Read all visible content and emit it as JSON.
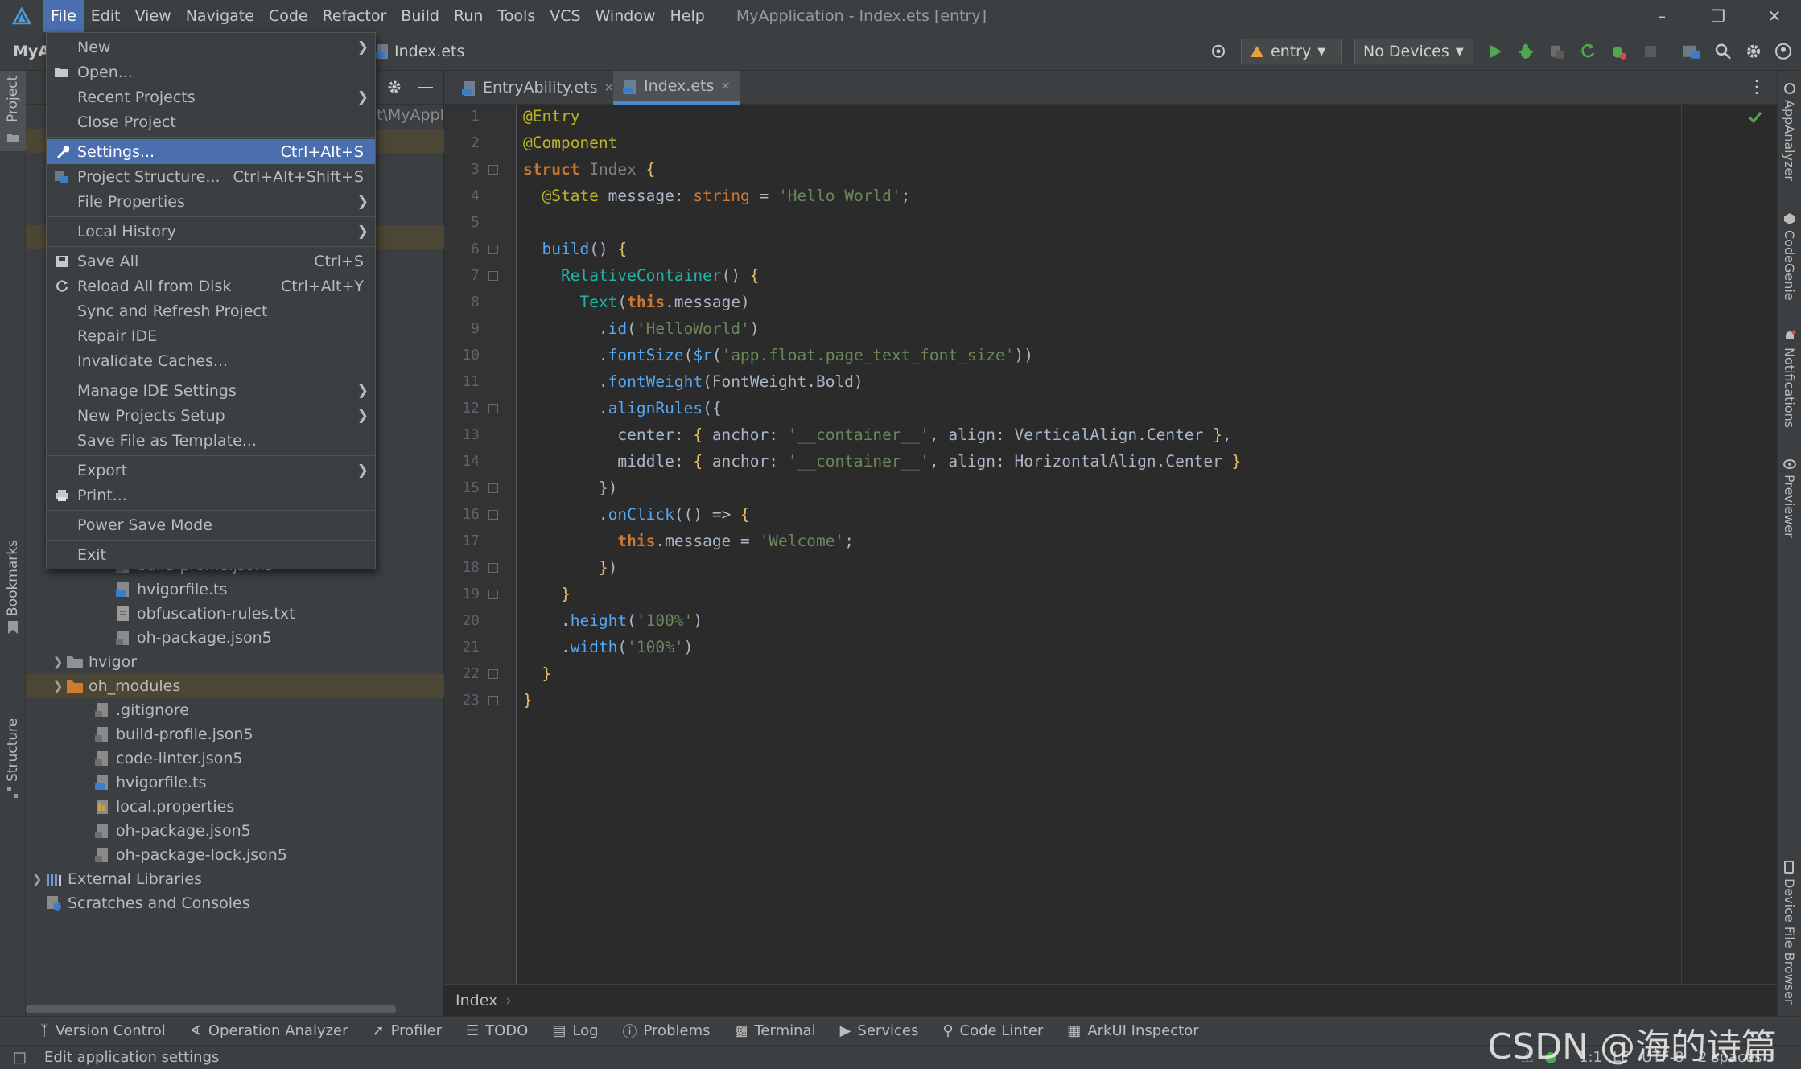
{
  "titlebar": {
    "menus": [
      "File",
      "Edit",
      "View",
      "Navigate",
      "Code",
      "Refactor",
      "Build",
      "Run",
      "Tools",
      "VCS",
      "Window",
      "Help"
    ],
    "window_title": "MyApplication - Index.ets [entry]"
  },
  "toolbar": {
    "project_label": "MyA",
    "breadcrumb_file": "Index.ets",
    "run_config": "entry",
    "device": "No Devices"
  },
  "left_stripe": {
    "project": "Project",
    "bookmarks": "Bookmarks",
    "structure": "Structure"
  },
  "right_stripe": {
    "app_analyzer": "AppAnalyzer",
    "code_genie": "CodeGenie",
    "notifications": "Notifications",
    "previewer": "Previewer",
    "device_file_browser": "Device File Browser"
  },
  "project_panel": {
    "path_fragment": "t\\MyAppl",
    "tree": [
      {
        "label": "build-profile.json5",
        "icon": "json-file-icon"
      },
      {
        "label": "hvigorfile.ts",
        "icon": "ts-file-icon"
      },
      {
        "label": "obfuscation-rules.txt",
        "icon": "text-file-icon"
      },
      {
        "label": "oh-package.json5",
        "icon": "json-file-icon"
      },
      {
        "label": "hvigor",
        "icon": "folder-icon"
      },
      {
        "label": "oh_modules",
        "icon": "folder-orange-icon"
      },
      {
        "label": ".gitignore",
        "icon": "json-file-icon"
      },
      {
        "label": "build-profile.json5",
        "icon": "json-file-icon"
      },
      {
        "label": "code-linter.json5",
        "icon": "json-file-icon"
      },
      {
        "label": "hvigorfile.ts",
        "icon": "ts-file-icon"
      },
      {
        "label": "local.properties",
        "icon": "properties-file-icon"
      },
      {
        "label": "oh-package.json5",
        "icon": "json-file-icon"
      },
      {
        "label": "oh-package-lock.json5",
        "icon": "json-file-icon"
      },
      {
        "label": "External Libraries",
        "icon": "library-icon"
      },
      {
        "label": "Scratches and Consoles",
        "icon": "scratch-icon"
      }
    ]
  },
  "file_menu": {
    "items": [
      {
        "label": "New",
        "shortcut": "",
        "submenu": true
      },
      {
        "label": "Open...",
        "shortcut": ""
      },
      {
        "label": "Recent Projects",
        "shortcut": "",
        "submenu": true
      },
      {
        "label": "Close Project",
        "shortcut": ""
      },
      {
        "label": "Settings...",
        "shortcut": "Ctrl+Alt+S"
      },
      {
        "label": "Project Structure...",
        "shortcut": "Ctrl+Alt+Shift+S"
      },
      {
        "label": "File Properties",
        "shortcut": "",
        "submenu": true
      },
      {
        "label": "Local History",
        "shortcut": "",
        "submenu": true
      },
      {
        "label": "Save All",
        "shortcut": "Ctrl+S"
      },
      {
        "label": "Reload All from Disk",
        "shortcut": "Ctrl+Alt+Y"
      },
      {
        "label": "Sync and Refresh Project",
        "shortcut": ""
      },
      {
        "label": "Repair IDE",
        "shortcut": ""
      },
      {
        "label": "Invalidate Caches...",
        "shortcut": ""
      },
      {
        "label": "Manage IDE Settings",
        "shortcut": "",
        "submenu": true
      },
      {
        "label": "New Projects Setup",
        "shortcut": "",
        "submenu": true
      },
      {
        "label": "Save File as Template...",
        "shortcut": ""
      },
      {
        "label": "Export",
        "shortcut": "",
        "submenu": true
      },
      {
        "label": "Print...",
        "shortcut": ""
      },
      {
        "label": "Power Save Mode",
        "shortcut": ""
      },
      {
        "label": "Exit",
        "shortcut": ""
      }
    ]
  },
  "editor": {
    "tabs": [
      {
        "label": "EntryAbility.ets"
      },
      {
        "label": "Index.ets"
      }
    ],
    "line_numbers": [
      "1",
      "2",
      "3",
      "4",
      "5",
      "6",
      "7",
      "8",
      "9",
      "10",
      "11",
      "12",
      "13",
      "14",
      "15",
      "16",
      "17",
      "18",
      "19",
      "20",
      "21",
      "22",
      "23"
    ],
    "breadcrumb": "Index"
  },
  "bottom_tools": {
    "version_control": "Version Control",
    "operation_analyzer": "Operation Analyzer",
    "profiler": "Profiler",
    "todo": "TODO",
    "log": "Log",
    "problems": "Problems",
    "terminal": "Terminal",
    "services": "Services",
    "code_linter": "Code Linter",
    "arkui_inspector": "ArkUI Inspector"
  },
  "status": {
    "message": "Edit application settings",
    "position": "1:1",
    "line_sep": "LF",
    "encoding": "UTF-8",
    "indent": "2 spaces",
    "watermark": "CSDN @海的诗篇"
  },
  "colors": {
    "menu_highlight": "#4b6eaf",
    "background": "#2b2b2b",
    "panel": "#3c3f41"
  }
}
